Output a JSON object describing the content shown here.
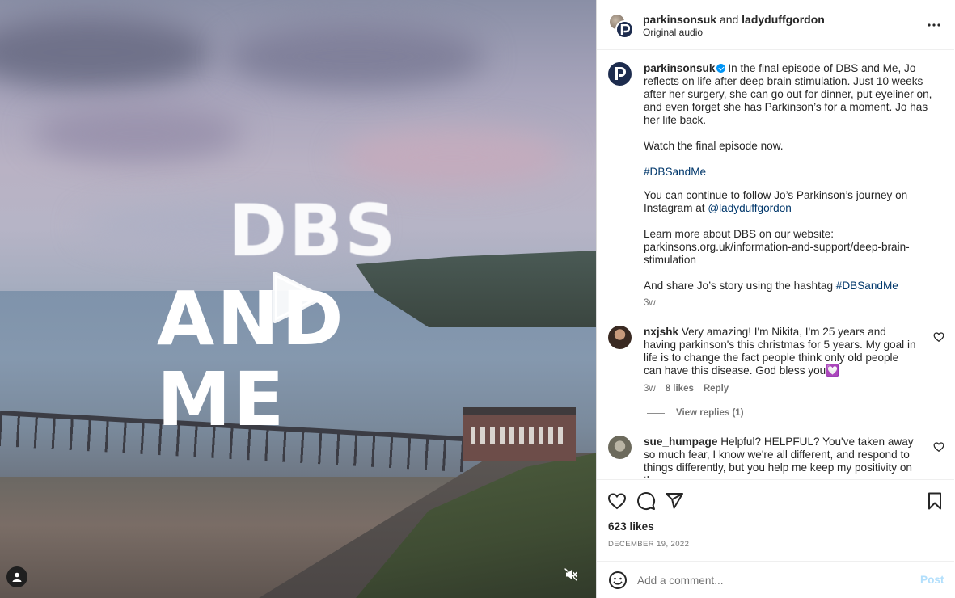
{
  "video": {
    "title_line1": "DBS",
    "title_line2": "AND ME",
    "icons": {
      "play": "play-icon",
      "user_tag": "user-icon",
      "mute": "speaker-muted-icon"
    }
  },
  "header": {
    "account1": "parkinsonsuk",
    "joiner": "and",
    "account2": "ladyduffgordon",
    "audio": "Original audio",
    "avatar_letter": "P",
    "more_icon": "more-horizontal-icon"
  },
  "caption": {
    "username": "parkinsonsuk",
    "text1": "In the final episode of DBS and Me, Jo reflects on life after deep brain stimulation. Just 10 weeks after her surgery, she can go out for dinner, put eyeliner on, and even forget she has Parkinson’s for a moment. Jo has her life back.",
    "text2": "Watch the final episode now.",
    "hashtag1": "#DBSandMe",
    "divider": "_________",
    "text3": "You can continue to follow Jo’s Parkinson’s journey on Instagram at",
    "mention": "@ladyduffgordon",
    "text4": "Learn more about DBS on our website: parkinsons.org.uk/information-and-support/deep-brain-stimulation",
    "text5": "And share Jo’s story using the hashtag",
    "hashtag2": "#DBSandMe",
    "time": "3w"
  },
  "comments": [
    {
      "username": "nxjshk",
      "text": "Very amazing! I'm Nikita, I'm 25 years and having parkinson's this christmas for 5 years. My goal in life is to change the fact people think only old people can have this disease. God bless you💟",
      "time": "3w",
      "likes": "8 likes",
      "reply": "Reply",
      "view_replies": "View replies (1)"
    },
    {
      "username": "sue_humpage",
      "text": "Helpful? HELPFUL? You've taken away so much fear, I know we're all different, and respond to things differently, but you help me keep my positivity on the"
    }
  ],
  "actions": {
    "icons": [
      "heart-icon",
      "comment-icon",
      "share-icon",
      "bookmark-icon"
    ],
    "likes": "623 likes",
    "date": "DECEMBER 19, 2022"
  },
  "comment_box": {
    "placeholder": "Add a comment...",
    "post_label": "Post",
    "emoji_icon": "emoji-icon"
  },
  "colors": {
    "link": "#00376b",
    "verified": "#0095f6",
    "post_disabled": "#b2dffc",
    "secondary_text": "#737373"
  }
}
